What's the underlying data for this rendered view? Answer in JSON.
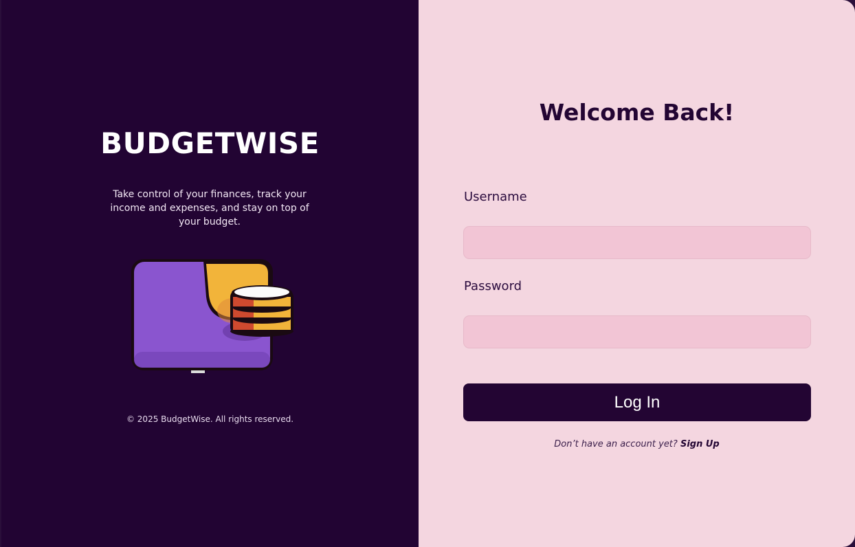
{
  "brand": {
    "title": "BUDGETWISE",
    "tagline": "Take control of your finances, track your income and expenses, and stay on top of your budget.",
    "copyright": "© 2025 BudgetWise. All rights reserved.",
    "illustration_icon": "wallet-coins-icon"
  },
  "login": {
    "heading": "Welcome Back!",
    "username_label": "Username",
    "username_value": "",
    "password_label": "Password",
    "password_value": "",
    "submit_label": "Log In",
    "signup_prompt": "Don’t have an account yet?",
    "signup_link": "Sign Up"
  },
  "colors": {
    "left_panel_bg": "#220433",
    "right_panel_bg": "#f4d6e0",
    "input_bg": "#f2c5d5",
    "primary_button": "#230533",
    "wallet_purple": "#8a55cf",
    "wallet_yellow": "#f2b43a",
    "coin_red": "#cf4a2f"
  }
}
